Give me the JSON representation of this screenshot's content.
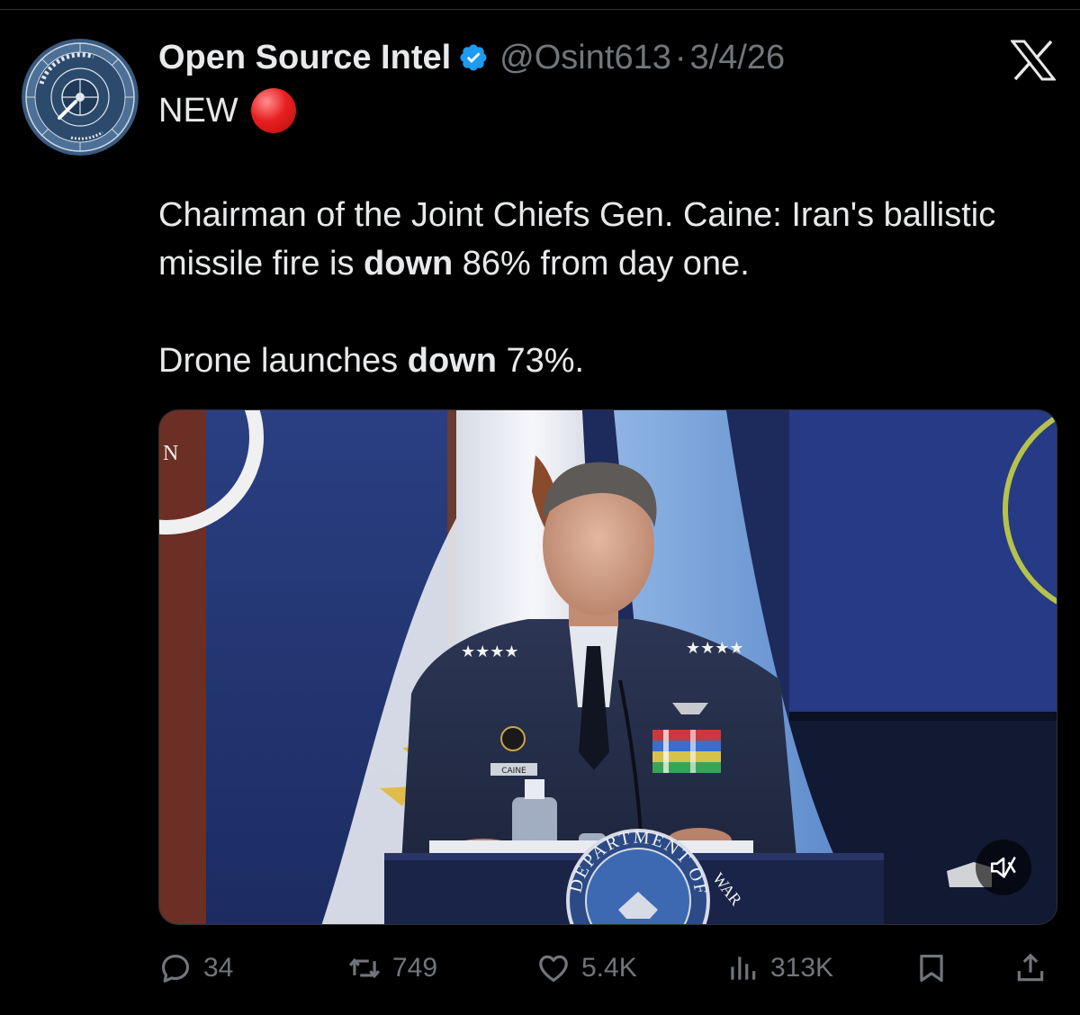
{
  "tweet": {
    "author": {
      "display_name": "Open Source Intel",
      "handle": "@Osint613",
      "verified": true
    },
    "date_separator": "·",
    "date": "3/4/26",
    "first_line": "NEW",
    "text": {
      "p1_a": "Chairman of the Joint Chiefs Gen. Caine: Iran's ballistic missile fire is ",
      "p1_bold": "down",
      "p1_b": " 86% from day one.",
      "p2_a": "Drone launches ",
      "p2_bold": "down",
      "p2_b": " 73%."
    },
    "media": {
      "seal_top": "DEPARTMENT OF",
      "seal_right": "WAR",
      "nameplate": "CAINE"
    },
    "stats": {
      "replies": "34",
      "reposts": "749",
      "likes": "5.4K",
      "views": "313K"
    }
  },
  "colors": {
    "background": "#000000",
    "primary_text": "#e7e9ea",
    "secondary_text": "#71767b",
    "verified_badge": "#1d9bf0",
    "divider": "#2f3336"
  },
  "icons": [
    "verified-badge-icon",
    "red-circle-emoji",
    "x-logo-icon",
    "mute-icon",
    "reply-icon",
    "repost-icon",
    "like-icon",
    "views-icon",
    "bookmark-icon",
    "share-icon"
  ]
}
